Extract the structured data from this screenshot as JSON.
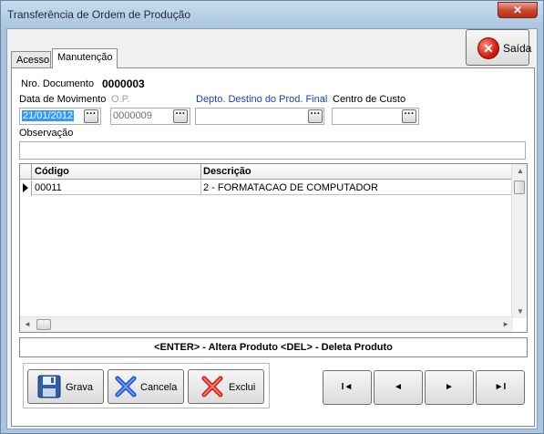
{
  "window": {
    "title": "Transferência de Ordem de Produção",
    "close_label": "✕"
  },
  "tabs": [
    {
      "label": "Acesso"
    },
    {
      "label": "Manutenção"
    }
  ],
  "exit_button": {
    "label": "Saída"
  },
  "form": {
    "doc_label": "Nro. Documento",
    "doc_value": "0000003",
    "data_mov_label": "Data de Movimento",
    "data_mov_value": "21/01/2012",
    "op_label": "O.P.",
    "op_value": "0000009",
    "depto_label": "Depto. Destino do Prod. Final",
    "depto_value": "",
    "centro_label": "Centro de Custo",
    "centro_value": "",
    "obs_label": "Observação",
    "obs_value": "",
    "lookup_label": "···"
  },
  "grid": {
    "columns": [
      "Código",
      "Descrição"
    ],
    "rows": [
      {
        "codigo": "00011",
        "descricao": "2 - FORMATACAO DE COMPUTADOR"
      }
    ]
  },
  "hint": "<ENTER> - Altera Produto    <DEL> - Deleta Produto",
  "actions": {
    "grava": "Grava",
    "cancela": "Cancela",
    "exclui": "Exclui"
  },
  "nav": {
    "first": "I◄",
    "prev": "◄",
    "next": "►",
    "last": "►I"
  },
  "colors": {
    "accent_blue": "#1c3fb8",
    "selection": "#3399ff"
  }
}
